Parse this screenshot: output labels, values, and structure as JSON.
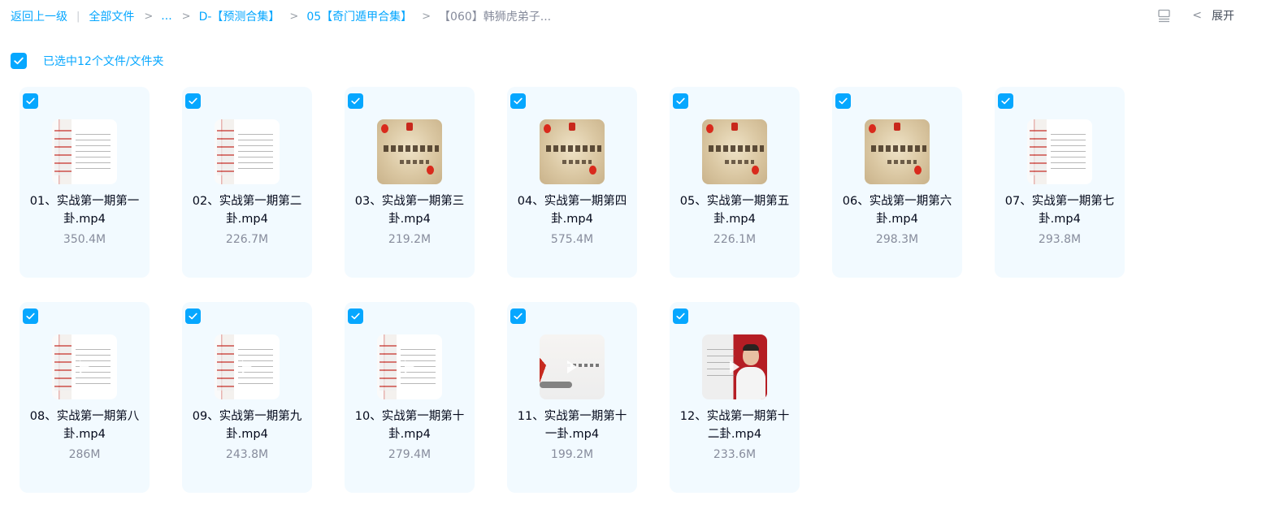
{
  "breadcrumb": {
    "back": "返回上一级",
    "all_files": "全部文件",
    "ellipsis": "...",
    "level1": "D-【预测合集】",
    "level2": "05【奇门遁甲合集】",
    "current": "【060】韩狮虎弟子..."
  },
  "toolbar": {
    "expand_label": "展开"
  },
  "selection": {
    "label": "已选中12个文件/文件夹"
  },
  "files": [
    {
      "name": "01、实战第一期第一卦.mp4",
      "size": "350.4M",
      "thumb": "slide-a"
    },
    {
      "name": "02、实战第一期第二卦.mp4",
      "size": "226.7M",
      "thumb": "slide-a"
    },
    {
      "name": "03、实战第一期第三卦.mp4",
      "size": "219.2M",
      "thumb": "cover"
    },
    {
      "name": "04、实战第一期第四卦.mp4",
      "size": "575.4M",
      "thumb": "cover"
    },
    {
      "name": "05、实战第一期第五卦.mp4",
      "size": "226.1M",
      "thumb": "cover"
    },
    {
      "name": "06、实战第一期第六卦.mp4",
      "size": "298.3M",
      "thumb": "cover"
    },
    {
      "name": "07、实战第一期第七卦.mp4",
      "size": "293.8M",
      "thumb": "slide-a"
    },
    {
      "name": "08、实战第一期第八卦.mp4",
      "size": "286M",
      "thumb": "slide-a"
    },
    {
      "name": "09、实战第一期第九卦.mp4",
      "size": "243.8M",
      "thumb": "slide-a"
    },
    {
      "name": "10、实战第一期第十卦.mp4",
      "size": "279.4M",
      "thumb": "slide-a"
    },
    {
      "name": "11、实战第一期第十一卦.mp4",
      "size": "199.2M",
      "thumb": "white-red"
    },
    {
      "name": "12、实战第一期第十二卦.mp4",
      "size": "233.6M",
      "thumb": "person"
    }
  ],
  "colors": {
    "accent": "#06a7ff",
    "card_bg": "#f2faff",
    "text_secondary": "#878c9c"
  }
}
